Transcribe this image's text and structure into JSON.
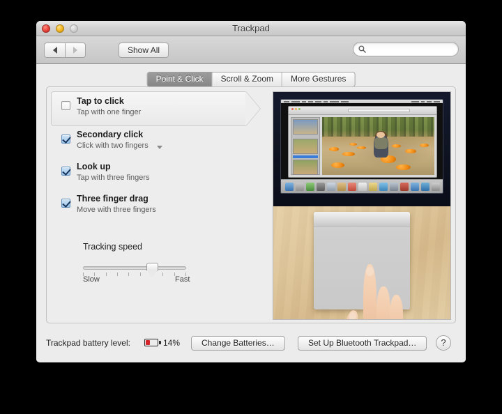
{
  "window": {
    "title": "Trackpad",
    "traffic_lights": [
      "close-button",
      "minimize-button",
      "zoom-button"
    ]
  },
  "toolbar": {
    "back_label": "◀",
    "forward_label": "▶",
    "show_all_label": "Show All",
    "search": {
      "value": "",
      "placeholder": ""
    }
  },
  "tabs": [
    {
      "label": "Point & Click",
      "active": true
    },
    {
      "label": "Scroll & Zoom",
      "active": false
    },
    {
      "label": "More Gestures",
      "active": false
    }
  ],
  "options": [
    {
      "title": "Tap to click",
      "subtitle": "Tap with one finger",
      "checked": false,
      "selected": true,
      "has_dropdown": false
    },
    {
      "title": "Secondary click",
      "subtitle": "Click with two fingers",
      "checked": true,
      "selected": false,
      "has_dropdown": true
    },
    {
      "title": "Look up",
      "subtitle": "Tap with three fingers",
      "checked": true,
      "selected": false,
      "has_dropdown": false
    },
    {
      "title": "Three finger drag",
      "subtitle": "Move with three fingers",
      "checked": true,
      "selected": false,
      "has_dropdown": false
    }
  ],
  "tracking_speed": {
    "label": "Tracking speed",
    "min_label": "Slow",
    "max_label": "Fast",
    "value": 7,
    "ticks": 10
  },
  "bottom_bar": {
    "battery_label": "Trackpad battery level:",
    "battery_percent": "14%",
    "battery_fill_color": "#d4262a",
    "change_batteries_label": "Change Batteries…",
    "setup_bluetooth_label": "Set Up Bluetooth Trackpad…",
    "help_label": "?"
  },
  "preview": {
    "description": "Demo video: Mac desktop showing a photo of a girl sitting on a pumpkin in a pumpkin patch, above a Magic Trackpad on a wooden desk with a hand tapping with one finger."
  }
}
